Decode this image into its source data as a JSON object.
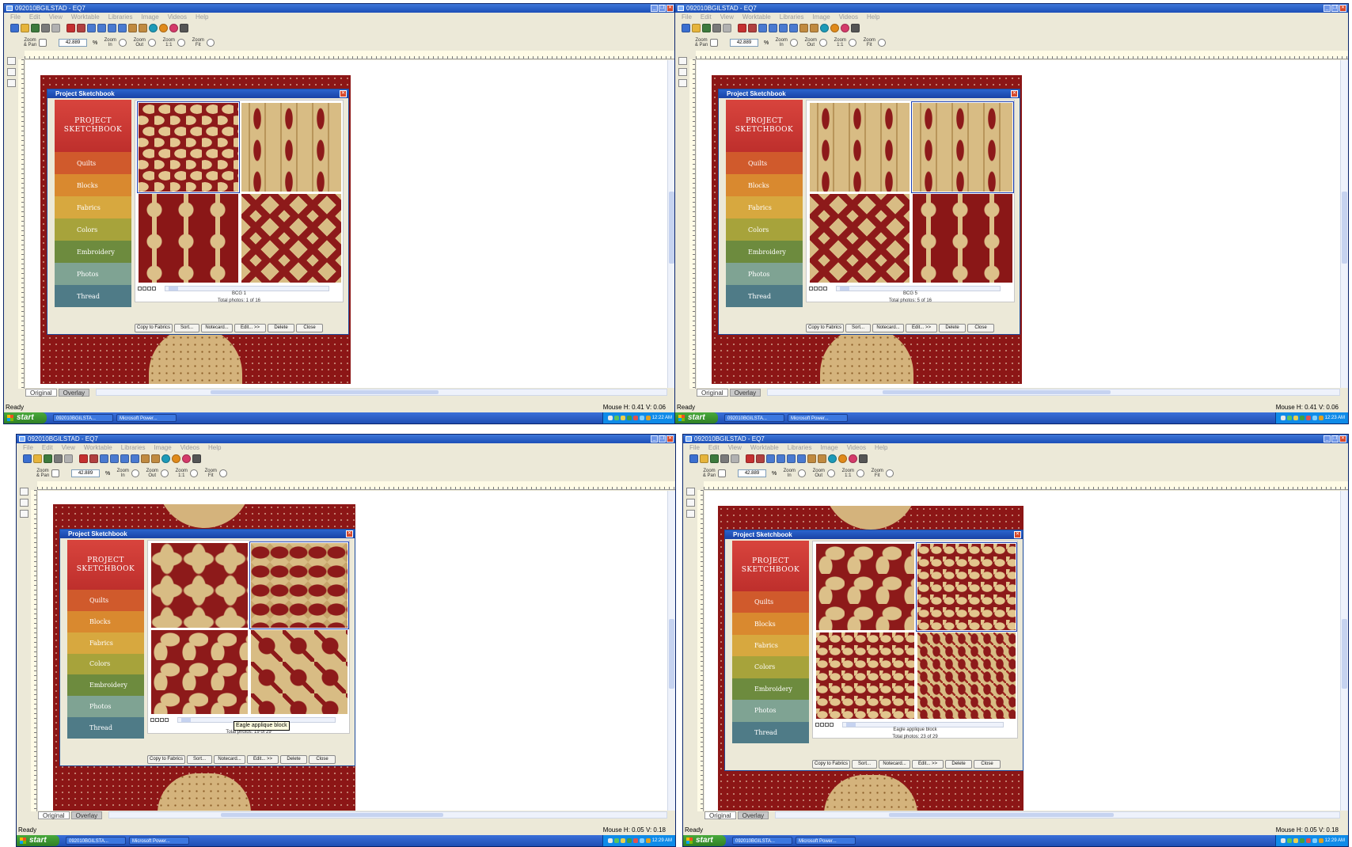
{
  "colors": {
    "titlebar": "#2a5fc9",
    "quilt_red": "#8d1a1a",
    "quilt_tan": "#d8bc84",
    "sidebar": {
      "header": "#c8332f",
      "quilts": "#d05a2c",
      "blocks": "#d9892f",
      "fabrics": "#d7a83f",
      "colors": "#a7a33b",
      "embroidery": "#6d8b3e",
      "photos": "#7fa393",
      "thread": "#4f7b87"
    }
  },
  "common": {
    "window_title": "092010BGILSTAD - EQ7",
    "menu": [
      "File",
      "Edit",
      "View",
      "Worktable",
      "Libraries",
      "Image",
      "Videos",
      "Help"
    ],
    "zoom_value": "42.889",
    "zoom_percent": "%",
    "zoom_labels": [
      "Zoom & Pan",
      "Zoom In",
      "Zoom Out",
      "Zoom 1:1",
      "Zoom Fit"
    ],
    "tabs": [
      "Original",
      "Overlay"
    ],
    "status_ready": "Ready",
    "dialog_title": "Project Sketchbook",
    "sidebar_header": [
      "PROJECT",
      "SKETCHBOOK"
    ],
    "sidebar_items": [
      "Quilts",
      "Blocks",
      "Fabrics",
      "Colors",
      "Embroidery",
      "Photos",
      "Thread"
    ],
    "buttons": [
      "Copy to Fabrics",
      "Sort...",
      "Notecard...",
      "Edit... >>",
      "Delete",
      "Close"
    ],
    "start": "start",
    "taskbar_items": [
      "092010BGILSTA...",
      "Microsoft Power..."
    ]
  },
  "panels": [
    {
      "caption_name": "BCG 1",
      "caption_total": "Total photos: 1 of 16",
      "mouse": "Mouse  H: 0.41   V: 0.06",
      "clock": "12:22 AM",
      "tooltip": "",
      "patterns": [
        "pa",
        "pb",
        "pc",
        "pd"
      ],
      "selected": 0
    },
    {
      "caption_name": "BCG 5",
      "caption_total": "Total photos: 5 of 16",
      "mouse": "Mouse  H: 0.41   V: 0.06",
      "clock": "12:23 AM",
      "tooltip": "",
      "patterns": [
        "pb",
        "pb",
        "pd",
        "pc"
      ],
      "selected": 1
    },
    {
      "caption_name": "Eagle ap",
      "caption_total": "Total photos: 19 of 29",
      "mouse": "Mouse  H: 0.05   V: 0.18",
      "clock": "12:29 AM",
      "tooltip": "Eagle applique block",
      "patterns": [
        "pe",
        "pf",
        "pg",
        "ph"
      ],
      "selected": 1
    },
    {
      "caption_name": "Eagle applique block",
      "caption_total": "Total photos: 23 of 29",
      "mouse": "Mouse  H: 0.05   V: 0.18",
      "clock": "12:29 AM",
      "tooltip": "",
      "patterns": [
        "pg",
        "pi",
        "pi",
        "pj"
      ],
      "selected": 1
    }
  ]
}
